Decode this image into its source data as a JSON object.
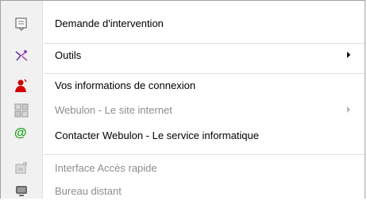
{
  "menu": {
    "items": [
      {
        "label": "Demande d'intervention",
        "icon": "form-icon",
        "enabled": true
      },
      {
        "label": "Outils",
        "icon": "tools-icon",
        "enabled": true,
        "submenu": true
      },
      {
        "label": "Vos informations de connexion",
        "icon": "user-icon",
        "enabled": true
      },
      {
        "label": "Webulon - Le site internet",
        "icon": "website-icon",
        "enabled": false,
        "submenu": true
      },
      {
        "label": "Contacter Webulon - Le service informatique",
        "icon": "at-sign-icon",
        "enabled": true
      },
      {
        "label": "Interface Accès rapide",
        "icon": "quick-access-icon",
        "enabled": false
      },
      {
        "label": "Bureau distant",
        "icon": "remote-desktop-icon",
        "enabled": false
      }
    ]
  },
  "colors": {
    "gutter": "#f1f1f1",
    "disabled_text": "#8d8d8d",
    "user_icon": "#d40000",
    "at_icon": "#1aa01a"
  }
}
